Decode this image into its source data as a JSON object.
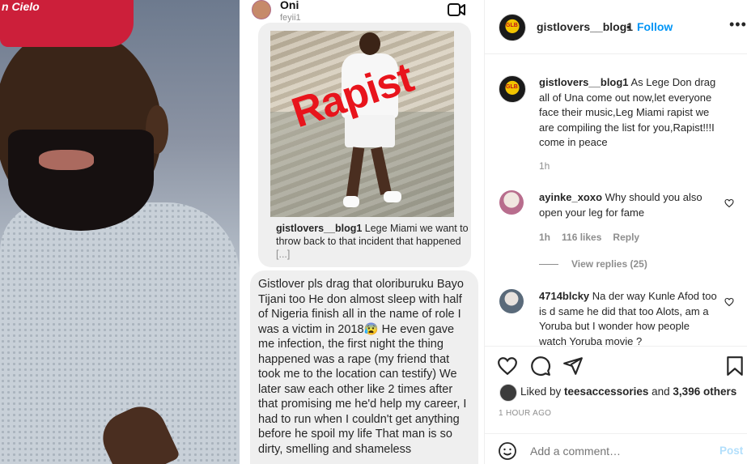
{
  "left_photo": {
    "cap_text": "n Cielo"
  },
  "dm": {
    "name": "Oni",
    "handle": "feyii1",
    "shared_overlay_text": "Rapist",
    "shared_caption_user": "gistlovers__blog1",
    "shared_caption_text": " Lege Miami we want to throw back to that incident that happened",
    "shared_caption_more": "[...]",
    "message": "Gistlover pls drag that oloriburuku Bayo Tijani too He don almost sleep with half of Nigeria finish all in the name of role I was a victim in 2018😰 He even gave me infection, the first night the thing happened was a rape (my friend that took me to the location can testify)  We later saw each other like 2 times after that promising me he'd help my career, I had to run when I couldn't get anything before he spoil my life That man is so dirty, smelling and shameless"
  },
  "post": {
    "account": "gistlovers__blog1",
    "dot": "•",
    "follow_label": "Follow",
    "more_label": "•••",
    "avatar_text": "GLB",
    "caption_user": "gistlovers__blog1",
    "caption_text": " As Lege Don drag all of Una come out now,let everyone face their music,Leg Miami rapist we are compiling the list for you,Rapist!!!I come in peace",
    "caption_time": "1h"
  },
  "comments": [
    {
      "user": "ayinke_xoxo",
      "text": " Why should you also open your leg for fame",
      "time": "1h",
      "likes": "116 likes",
      "reply_label": "Reply",
      "view_replies": "View replies (25)"
    },
    {
      "user": "4714blcky",
      "text": " Na der way Kunle Afod too is d same he did that too Alots, am a Yoruba but I wonder how people watch Yoruba movie ?"
    }
  ],
  "engagement": {
    "liked_by_prefix": "Liked by ",
    "liked_by_user": "teesaccessories",
    "liked_by_suffix": " and ",
    "others": "3,396 others",
    "time_ago": "1 HOUR AGO",
    "add_comment_placeholder": "Add a comment…",
    "post_label": "Post"
  },
  "colors": {
    "link_blue": "#0095f6",
    "post_disabled": "#b2dffc",
    "rapist_red": "#e8141c"
  },
  "icons": [
    "video-call-icon",
    "heart-icon",
    "comment-icon",
    "share-icon",
    "bookmark-icon",
    "emoji-icon"
  ]
}
